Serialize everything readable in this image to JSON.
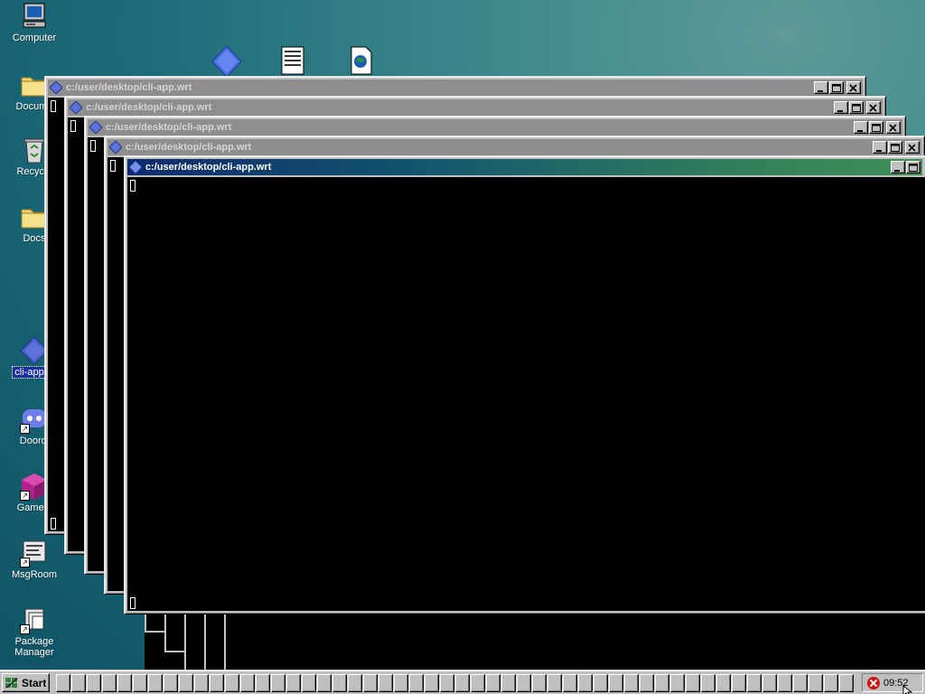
{
  "desktop": {
    "icons": [
      {
        "label": "Computer"
      },
      {
        "label": "Docume"
      },
      {
        "label": "Recycle"
      },
      {
        "label": "Docs"
      },
      {
        "label": "cli-app.w"
      },
      {
        "label": "Doordi"
      },
      {
        "label": "Gamein"
      },
      {
        "label": "MsgRoom"
      },
      {
        "label": "Package Manager"
      }
    ]
  },
  "windows": [
    {
      "title": "c:/user/desktop/cli-app.wrt",
      "active": false
    },
    {
      "title": "c:/user/desktop/cli-app.wrt",
      "active": false
    },
    {
      "title": "c:/user/desktop/cli-app.wrt",
      "active": false
    },
    {
      "title": "c:/user/desktop/cli-app.wrt",
      "active": false
    },
    {
      "title": "c:/user/desktop/cli-app.wrt",
      "active": true
    }
  ],
  "taskbar": {
    "start_label": "Start",
    "clock": "09:52"
  },
  "colors": {
    "active_title_start": "#0c2a6e",
    "active_title_end": "#3f8f56",
    "inactive_title": "#8e8e8e",
    "desktop": "#1f6e7c"
  }
}
